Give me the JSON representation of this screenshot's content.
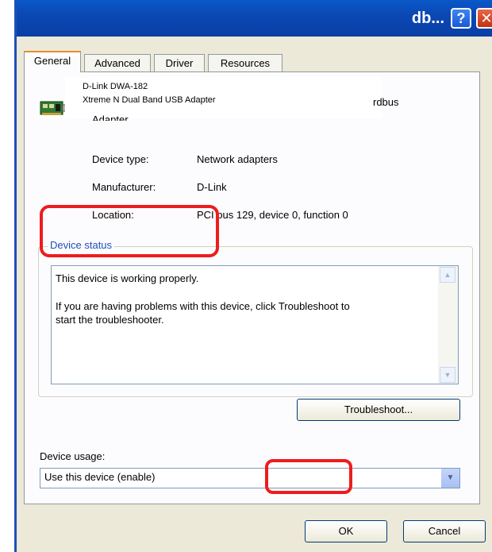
{
  "window": {
    "title_fragment": "db...",
    "help_glyph": "?",
    "close_glyph": "✕",
    "accent_color": "#0a4fc0"
  },
  "tabs": [
    "General",
    "Advanced",
    "Driver",
    "Resources"
  ],
  "device": {
    "name_line1": "D-Link DWA-182",
    "name_line2": "Xtreme N Dual Band USB Adapter",
    "name_fragment_right": "rdbus",
    "name_fragment_adapter": "Adapter"
  },
  "properties": [
    {
      "label": "Device type:",
      "value": "Network adapters"
    },
    {
      "label": "Manufacturer:",
      "value": "D-Link"
    },
    {
      "label": "Location:",
      "value": "PCI bus 129, device 0, function 0"
    }
  ],
  "status": {
    "group_title": "Device status",
    "line1": "This device is working properly.",
    "line2": "If you are having problems with this device, click Troubleshoot to",
    "line3": "start the troubleshooter."
  },
  "buttons": {
    "troubleshoot": "Troubleshoot...",
    "ok": "OK",
    "cancel": "Cancel"
  },
  "usage": {
    "label": "Device usage:",
    "selected": "Use this device (enable)"
  },
  "annotation_color": "#ee1c1c"
}
